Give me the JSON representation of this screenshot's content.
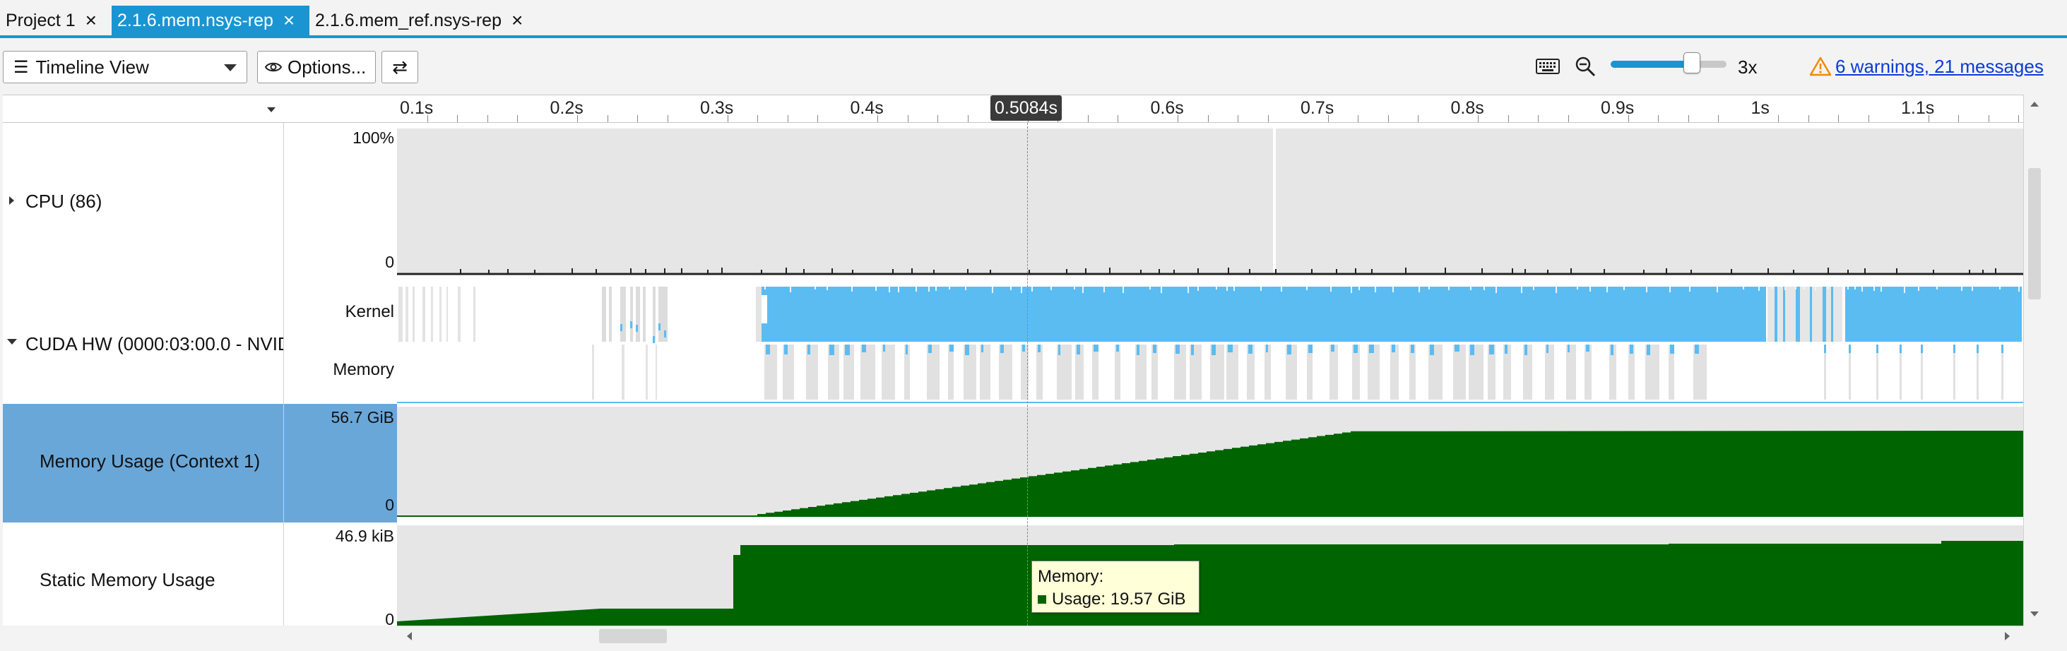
{
  "tabs": [
    {
      "label": "Project 1",
      "active": false
    },
    {
      "label": "2.1.6.mem.nsys-rep",
      "active": true
    },
    {
      "label": "2.1.6.mem_ref.nsys-rep",
      "active": false
    }
  ],
  "toolbar": {
    "view_label": "Timeline View",
    "options_label": "Options...",
    "zoom_level": "3x",
    "zoom_slider_fraction": 0.7,
    "messages_link": "6 warnings, 21 messages"
  },
  "ruler": {
    "ticks": [
      "0.1s",
      "0.2s",
      "0.3s",
      "0.4s",
      "0.5s",
      "0.6s",
      "0.7s",
      "0.8s",
      "0.9s",
      "1s",
      "1.1s"
    ],
    "cursor_time": "0.5084s"
  },
  "rows": {
    "cpu": {
      "label": "CPU (86)",
      "scale_max": "100%",
      "scale_min": "0"
    },
    "cuda": {
      "label": "CUDA HW (0000:03:00.0 - NVIDIA",
      "kernel_label": "Kernel",
      "memory_label": "Memory"
    },
    "memory_usage": {
      "label": "Memory Usage (Context 1)",
      "scale_max": "56.7 GiB",
      "scale_min": "0"
    },
    "static_memory": {
      "label": "Static Memory Usage",
      "scale_max": "46.9 kiB",
      "scale_min": "0"
    }
  },
  "tooltip": {
    "title": "Memory:",
    "entry": "Usage: 19.57 GiB"
  },
  "colors": {
    "accent": "#1a95d2",
    "kernel": "#5bbcf2",
    "memory_fill": "#006400",
    "selected_row": "#6aa7d9",
    "link": "#0b3bd6",
    "warning": "#f08a00"
  }
}
